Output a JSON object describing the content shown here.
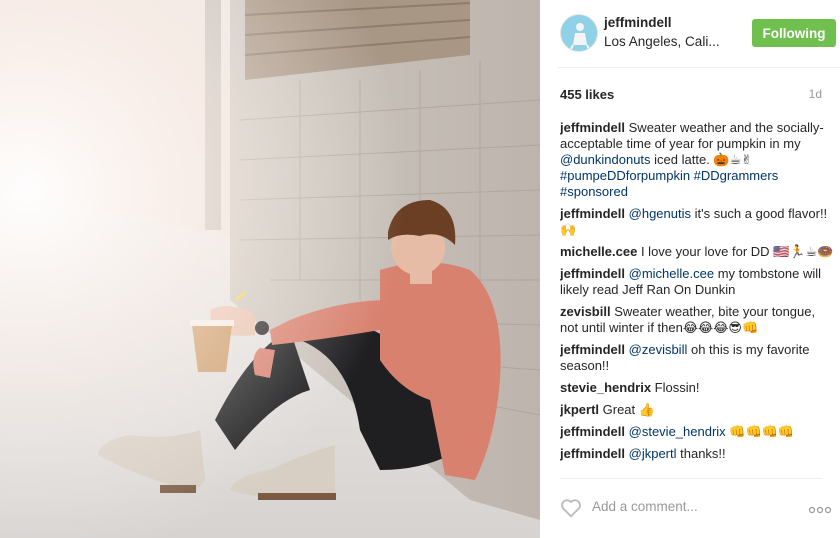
{
  "post": {
    "username": "jeffmindell",
    "location": "Los Angeles, Cali...",
    "follow_label": "Following",
    "likes": "455 likes",
    "age": "1d"
  },
  "comments": [
    {
      "author": "jeffmindell",
      "text": "Sweater weather and the socially-acceptable time of year for pumpkin in my ",
      "mention": "@dunkindonuts",
      "tail": " iced latte. 🎃☕✌",
      "tags": "#pumpeDDforpumpkin #DDgrammers #sponsored"
    },
    {
      "author": "jeffmindell",
      "mention": "@hgenutis",
      "text": " it's such a good flavor!! 🙌"
    },
    {
      "author": "michelle.cee",
      "text": "I love your love for DD 🇺🇸🏃☕🍩"
    },
    {
      "author": "jeffmindell",
      "mention": "@michelle.cee",
      "text": " my tombstone will likely read Jeff Ran On Dunkin"
    },
    {
      "author": "zevisbill",
      "text": "Sweater weather, bite your tongue, not until winter if then😂😂😂😎👊"
    },
    {
      "author": "jeffmindell",
      "mention": "@zevisbill",
      "text": " oh this is my favorite season!!"
    },
    {
      "author": "stevie_hendrix",
      "text": "Flossin!"
    },
    {
      "author": "jkpertl",
      "text": "Great 👍"
    },
    {
      "author": "jeffmindell",
      "mention": "@stevie_hendrix",
      "text": " 👊👊👊👊"
    },
    {
      "author": "jeffmindell",
      "mention": "@jkpertl",
      "text": " thanks!!"
    }
  ],
  "add_comment": {
    "placeholder": "Add a comment..."
  },
  "icons": {
    "like": "heart-outline-icon",
    "more": "more-options-icon",
    "avatar": "profile-avatar"
  },
  "colors": {
    "follow_green": "#70c050",
    "mention_blue": "#003569",
    "muted_gray": "#999999"
  }
}
